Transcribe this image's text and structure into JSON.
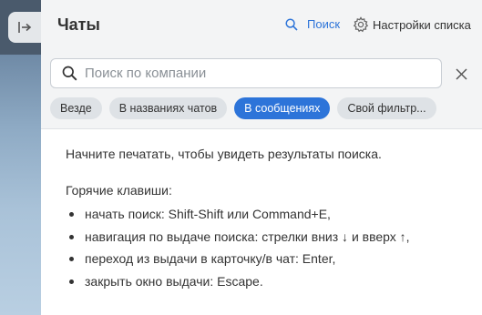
{
  "header": {
    "title": "Чаты",
    "search_label": "Поиск",
    "settings_label": "Настройки списка"
  },
  "search": {
    "placeholder": "Поиск по компании",
    "value": ""
  },
  "filters": [
    {
      "label": "Везде",
      "active": false
    },
    {
      "label": "В названиях чатов",
      "active": false
    },
    {
      "label": "В сообщениях",
      "active": true
    },
    {
      "label": "Свой фильтр...",
      "active": false
    }
  ],
  "content": {
    "hint": "Начните печатать, чтобы увидеть результаты поиска.",
    "hotkeys_title": "Горячие клавиши:",
    "hotkeys": [
      "начать поиск: Shift-Shift или Command+E,",
      "навигация по выдаче поиска: стрелки вниз ↓ и вверх ↑,",
      "переход из выдачи в карточку/в чат: Enter,",
      "закрыть окно выдачи: Escape."
    ]
  },
  "colors": {
    "accent": "#2d74d9",
    "header_bg": "#f3f4f5",
    "chip_bg": "#dee2e6"
  },
  "icons": {
    "collapse": "collapse-panel-icon",
    "search": "search-icon",
    "settings": "gear-icon",
    "close": "close-icon"
  }
}
